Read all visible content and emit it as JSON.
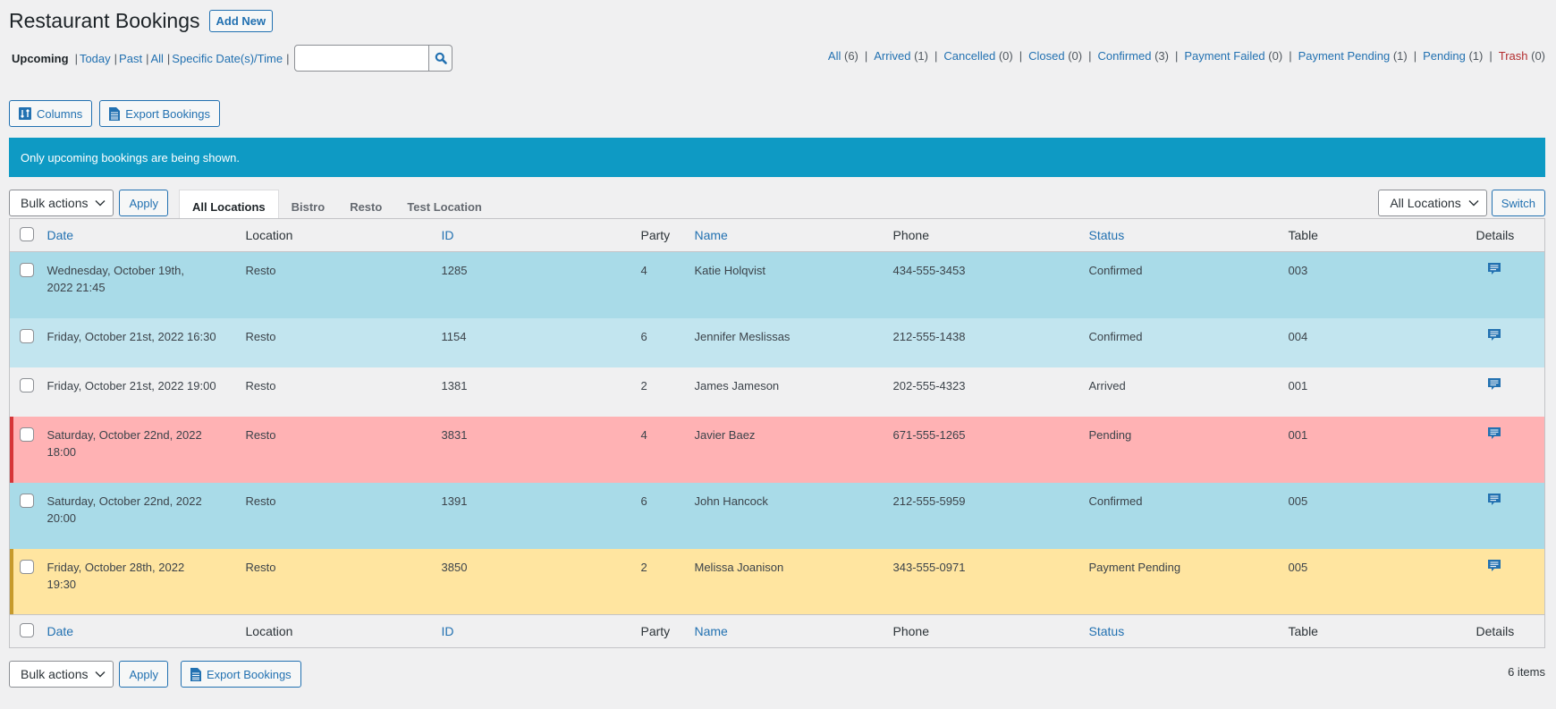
{
  "header": {
    "title": "Restaurant Bookings",
    "add_new_label": "Add New"
  },
  "date_filters": {
    "current": "Upcoming",
    "links": [
      "Today",
      "Past",
      "All",
      "Specific Date(s)/Time"
    ],
    "search_value": "",
    "search_icon": "search-icon"
  },
  "status_filters": [
    {
      "label": "All",
      "count": "(6)"
    },
    {
      "label": "Arrived",
      "count": "(1)"
    },
    {
      "label": "Cancelled",
      "count": "(0)"
    },
    {
      "label": "Closed",
      "count": "(0)"
    },
    {
      "label": "Confirmed",
      "count": "(3)"
    },
    {
      "label": "Payment Failed",
      "count": "(0)"
    },
    {
      "label": "Payment Pending",
      "count": "(1)"
    },
    {
      "label": "Pending",
      "count": "(1)"
    },
    {
      "label": "Trash",
      "count": "(0)"
    }
  ],
  "toolbar": {
    "columns_label": "Columns",
    "export_label": "Export Bookings"
  },
  "notice": "Only upcoming bookings are being shown.",
  "bulk": {
    "selected": "Bulk actions",
    "apply_label": "Apply"
  },
  "location_tabs": [
    {
      "label": "All Locations",
      "active": true
    },
    {
      "label": "Bistro",
      "active": false
    },
    {
      "label": "Resto",
      "active": false
    },
    {
      "label": "Test Location",
      "active": false
    }
  ],
  "location_switch": {
    "selected": "All Locations",
    "switch_label": "Switch"
  },
  "columns": {
    "date": "Date",
    "location": "Location",
    "id": "ID",
    "party": "Party",
    "name": "Name",
    "phone": "Phone",
    "status": "Status",
    "table": "Table",
    "details": "Details"
  },
  "rows": [
    {
      "date": "Wednesday, October 19th, 2022 21:45",
      "location": "Resto",
      "id": "1285",
      "party": "4",
      "name": "Katie Holqvist",
      "phone": "434-555-3453",
      "status": "Confirmed",
      "table": "003"
    },
    {
      "date": "Friday, October 21st, 2022 16:30",
      "location": "Resto",
      "id": "1154",
      "party": "6",
      "name": "Jennifer Meslissas",
      "phone": "212-555-1438",
      "status": "Confirmed",
      "table": "004"
    },
    {
      "date": "Friday, October 21st, 2022 19:00",
      "location": "Resto",
      "id": "1381",
      "party": "2",
      "name": "James Jameson",
      "phone": "202-555-4323",
      "status": "Arrived",
      "table": "001"
    },
    {
      "date": "Saturday, October 22nd, 2022 18:00",
      "location": "Resto",
      "id": "3831",
      "party": "4",
      "name": "Javier Baez",
      "phone": "671-555-1265",
      "status": "Pending",
      "table": "001"
    },
    {
      "date": "Saturday, October 22nd, 2022 20:00",
      "location": "Resto",
      "id": "1391",
      "party": "6",
      "name": "John Hancock",
      "phone": "212-555-5959",
      "status": "Confirmed",
      "table": "005"
    },
    {
      "date": "Friday, October 28th, 2022 19:30",
      "location": "Resto",
      "id": "3850",
      "party": "2",
      "name": "Melissa Joanison",
      "phone": "343-555-0971",
      "status": "Payment Pending",
      "table": "005"
    }
  ],
  "colors": {
    "accent": "#2271b1",
    "notice_bg": "#0e9ac4",
    "confirmed_row": "#a9dbe8",
    "pending_row": "#ffb2b4",
    "pending_marker": "#d63638",
    "payment_pending_row": "#ffe5a0",
    "payment_pending_marker": "#c69a2c",
    "trash_link": "#b32d2e"
  },
  "footer": {
    "items_count": "6 items"
  }
}
